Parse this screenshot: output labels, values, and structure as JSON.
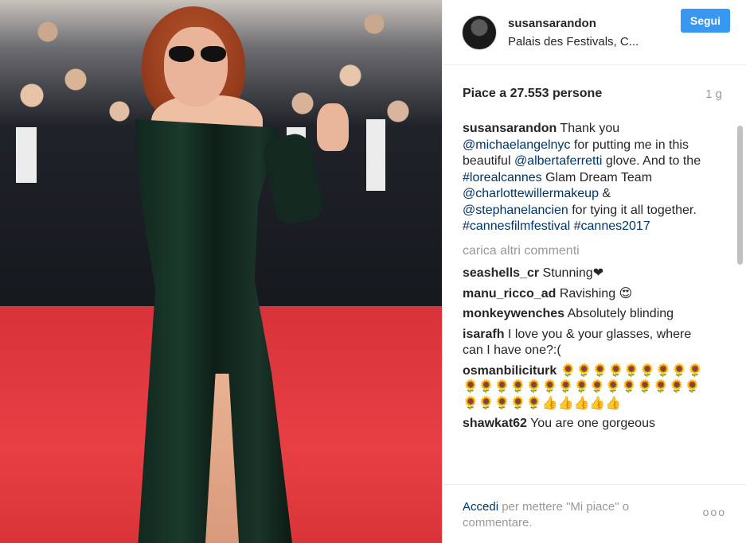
{
  "post": {
    "username": "susansarandon",
    "location": "Palais des Festivals, C...",
    "follow_label": "Segui",
    "likes_text": "Piace a 27.553 persone",
    "age": "1 g"
  },
  "caption": {
    "user": "susansarandon",
    "parts": [
      {
        "t": " Thank you ",
        "tag": false
      },
      {
        "t": "@michaelangelnyc",
        "tag": true
      },
      {
        "t": " for putting me in this beautiful ",
        "tag": false
      },
      {
        "t": "@albertaferretti",
        "tag": true
      },
      {
        "t": " glove. And to the ",
        "tag": false
      },
      {
        "t": "#lorealcannes",
        "tag": true
      },
      {
        "t": " Glam Dream Team ",
        "tag": false
      },
      {
        "t": "@charlottewillermakeup",
        "tag": true
      },
      {
        "t": " & ",
        "tag": false
      },
      {
        "t": "@stephanelancien",
        "tag": true
      },
      {
        "t": " for tying it all together. ",
        "tag": false
      },
      {
        "t": "#cannesfilmfestival",
        "tag": true
      },
      {
        "t": " ",
        "tag": false
      },
      {
        "t": "#cannes2017",
        "tag": true
      }
    ]
  },
  "load_more": "carica altri commenti",
  "comments": [
    {
      "user": "seashells_cr",
      "text": "Stunning❤"
    },
    {
      "user": "manu_ricco_ad",
      "text": "Ravishing 😍"
    },
    {
      "user": "monkeywenches",
      "text": "Absolutely blinding"
    },
    {
      "user": "isarafh",
      "text": "I love you & your glasses, where can I have one?:("
    },
    {
      "user": "osmanbiliciturk",
      "text": "🌻🌻🌻🌻🌻🌻🌻🌻🌻🌻🌻🌻🌻🌻🌻🌻🌻🌻🌻🌻🌻🌻🌻🌻🌻🌻🌻🌻🌻👍👍👍👍👍"
    },
    {
      "user": "shawkat62",
      "text": "You are one gorgeous"
    }
  ],
  "footer": {
    "login": "Accedi",
    "text": " per mettere \"Mi piace\" o commentare.",
    "more": "ooo"
  },
  "colors": {
    "accent": "#3897f0",
    "tag": "#003569",
    "muted": "#999999"
  }
}
